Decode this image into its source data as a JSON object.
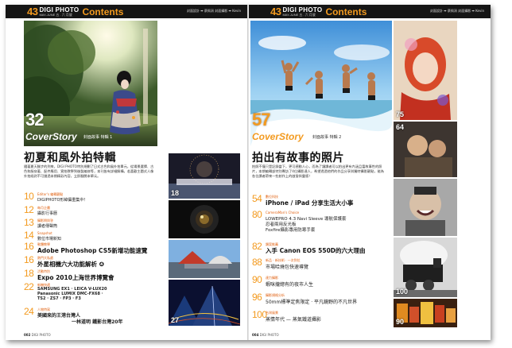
{
  "left_page": {
    "header": {
      "issue_num": "43",
      "brand": "DIGI PHOTO",
      "brand_sub": "MAY-JUNE 五 . 六 月號",
      "contents": "Contents",
      "credit": "封面設計 ➡ 蔡佩涓  封面攝影 ➡ Kevin"
    },
    "cover": {
      "page": "32",
      "label": "CoverStory",
      "sub": "封面故事 特輯 1"
    },
    "feature_title": "初夏和風外拍特輯",
    "feature_desc": "隨著夏天腳步的到來，DIGI PHOTO特別規劃了日式古色和風外拍單元，從場景選擇、古色和服穿著、配件應用、實拍教學到後製編修等，本刊皆有詳細解構，若喜歡主題式人像外拍絕對不可錯過本期精彩內容，立即翻閱本單元。",
    "toc": [
      {
        "num": "10",
        "cat": "Editor's 編輯觀點",
        "lines": [
          "DIGIPHOTO形綽攝重集中！"
        ]
      },
      {
        "num": "12",
        "cat": "每月企畫",
        "lines": [
          "攝影行事曆"
        ]
      },
      {
        "num": "13",
        "cat": "攝影問與答",
        "lines": [
          "讀者傳聲筒"
        ]
      },
      {
        "num": "14",
        "cat": "Snapshot",
        "lines": [
          "數位市場新知"
        ]
      },
      {
        "num": "16",
        "cat": "軟體教學",
        "big": "Adobe Photoshop CS5新增功能速覽"
      },
      {
        "num": "16",
        "cat": "熱門大私處",
        "big": "外星相機六大功能解析 ❹"
      },
      {
        "num": "18",
        "cat": "活動特別",
        "big": "Expo 2010上海世界博覽會"
      },
      {
        "num": "22",
        "cat": "新機快遞",
        "lines": [
          "SAMSUNG EX1 · LEICA V-LUX20",
          "Panasonic LUMIX DMC-FX68 ·",
          "TS2 · ZS7 · FP3 · F3"
        ]
      },
      {
        "num": "24",
        "cat": "人物特寫",
        "lines": [
          "美國來的王港台灣人",
          "一林道明 鐵影台灣20年"
        ]
      }
    ],
    "thumbs": [
      {
        "num": "18",
        "caption": "fireworks"
      },
      {
        "num": "",
        "caption": "camera"
      },
      {
        "num": "",
        "caption": "expo"
      },
      {
        "num": "27",
        "caption": "city night"
      }
    ],
    "footer": {
      "page": "002",
      "brand": "DIGI PHOTO"
    }
  },
  "right_page": {
    "header": {
      "issue_num": "43",
      "brand": "DIGI PHOTO",
      "brand_sub": "MAY-JUNE 五 . 六 月號",
      "contents": "Contents",
      "credit": "封面設計 ➡ 蔡佩涓  封面攝影 ➡ Kevin"
    },
    "cover": {
      "page": "57",
      "label": "CoverStory",
      "sub": "封面故事 特輯 2"
    },
    "feature_title": "拍出有故事的照片",
    "feature_desc": "拍照不僅只是記錄當下，更可感動人心，而為了讓讀者可以拍出更有內涵且富故事性的照片，本期編輯部特別專訪了4位攝影達人，希望透過他們的作品分享與獨特攝影觀點，能為各位讀者帶來一些創作上的啟發與靈感！",
    "toc": [
      {
        "num": "54",
        "cat": "數位科技",
        "big": "iPhone / iPad 分享生活大小事"
      },
      {
        "num": "80",
        "cat": "CameraMan's Choice",
        "lines": [
          "LOWEPRO 4.3 Navi Sleeve 導航保護套",
          "忍者兩用反光板",
          "Foxfire攝影專用防寒手套"
        ]
      },
      {
        "num": "82",
        "cat": "類案推薦",
        "big": "入手 Canon EOS 550D的六大理由"
      },
      {
        "num": "88",
        "cat": "新品 · 新技術 · 一次到位",
        "lines": [
          "市場哈燒包快速導覽"
        ]
      },
      {
        "num": "90",
        "cat": "達力攝影",
        "lines": [
          "蝦咪攏總有的夜市人生"
        ]
      },
      {
        "num": "96",
        "cat": "攝影規格分析",
        "lines": [
          "50mm標準定焦限定 · 平凡鏡野的不凡世界"
        ]
      },
      {
        "num": "100",
        "cat": "台灣風景",
        "lines": [
          "蒸情年代 — 蒸氣鐵道攝影"
        ]
      }
    ],
    "thumbs": [
      {
        "num": "75",
        "caption": "portrait"
      },
      {
        "num": "64",
        "caption": "children"
      },
      {
        "num": "",
        "caption": "laughing man"
      },
      {
        "num": "100",
        "caption": "steam train"
      },
      {
        "num": "90",
        "caption": "night market"
      }
    ],
    "footer": {
      "page": "004",
      "brand": "DIGI PHOTO"
    }
  }
}
